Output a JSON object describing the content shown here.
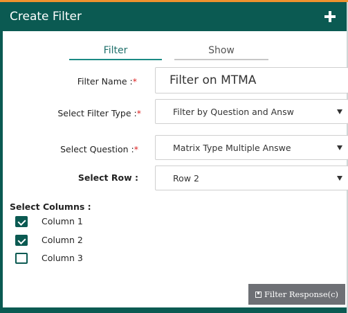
{
  "header": {
    "title": "Create Filter",
    "add_icon": "plus-icon"
  },
  "tabs": [
    {
      "label": "Filter",
      "active": true
    },
    {
      "label": "Show",
      "active": false
    }
  ],
  "form": {
    "filter_name": {
      "label": "Filter Name :",
      "required": "*",
      "value": "Filter on MTMA"
    },
    "filter_type": {
      "label": "Select Filter Type :",
      "required": "*",
      "value": "Filter by Question and Answ"
    },
    "question": {
      "label": "Select Question :",
      "required": "*",
      "value": "Matrix Type Multiple Answe"
    },
    "row": {
      "label": "Select Row :",
      "value": "Row 2"
    }
  },
  "columns": {
    "label": "Select Columns :",
    "items": [
      {
        "label": "Column 1",
        "checked": true
      },
      {
        "label": "Column 2",
        "checked": true
      },
      {
        "label": "Column 3",
        "checked": false
      }
    ]
  },
  "actions": {
    "filter_response_label": "Filter Response(c)",
    "filter_response_icon": "save-icon"
  },
  "colors": {
    "primary": "#0b5a52",
    "accent": "#f0922e",
    "tab_active": "#1a8a84",
    "button": "#6e7075"
  }
}
